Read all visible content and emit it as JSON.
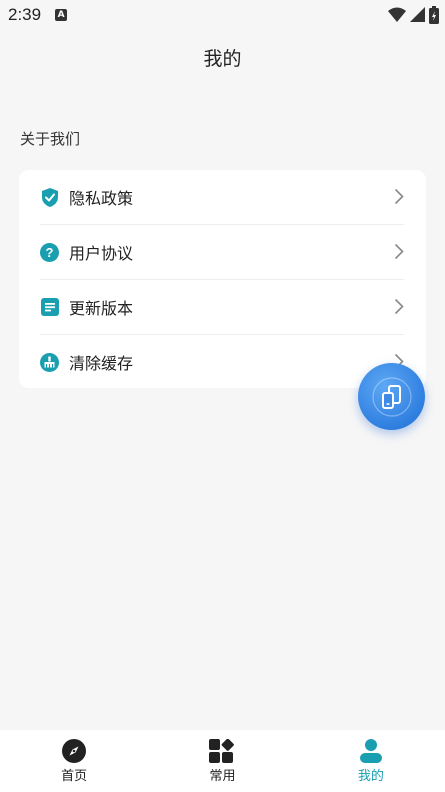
{
  "status": {
    "time": "2:39",
    "app_icon_letter": "A"
  },
  "header": {
    "title": "我的"
  },
  "section": {
    "label": "关于我们"
  },
  "menu": {
    "items": [
      {
        "label": "隐私政策",
        "icon": "shield-check-icon"
      },
      {
        "label": "用户协议",
        "icon": "question-circle-icon"
      },
      {
        "label": "更新版本",
        "icon": "document-list-icon"
      },
      {
        "label": "清除缓存",
        "icon": "broom-icon"
      }
    ]
  },
  "fab": {
    "icon": "phone-transfer-icon"
  },
  "tabs": {
    "items": [
      {
        "label": "首页",
        "icon": "compass-icon"
      },
      {
        "label": "常用",
        "icon": "grid-apps-icon"
      },
      {
        "label": "我的",
        "icon": "user-icon",
        "active": true
      }
    ]
  },
  "colors": {
    "accent": "#1a9fb0",
    "fab": "#2f7fe0",
    "background": "#f6f6f6"
  }
}
